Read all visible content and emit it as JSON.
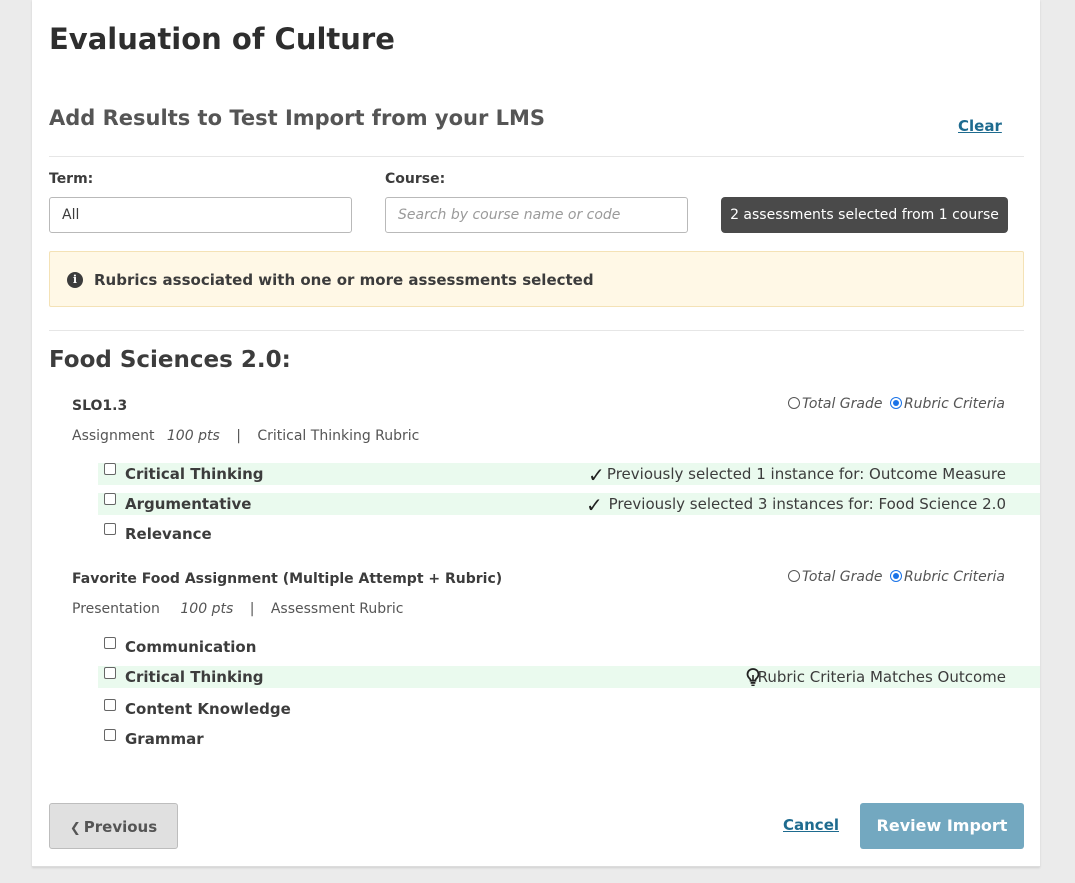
{
  "page_title": "Evaluation of Culture",
  "section": {
    "title": "Add Results to Test Import from your LMS",
    "clear_label": "Clear"
  },
  "filters": {
    "term_label": "Term:",
    "term_value": "All",
    "course_label": "Course:",
    "course_placeholder": "Search by course name or code",
    "selection_summary": "2 assessments selected from 1 course"
  },
  "notice": {
    "icon": "info-icon",
    "text": "Rubrics associated with one or more assessments selected"
  },
  "group": {
    "title": "Food Sciences 2.0:",
    "assessments": [
      {
        "name": "SLO1.3",
        "type": "Assignment",
        "points": "100 pts",
        "separator": "|",
        "rubric": "Critical Thinking Rubric",
        "options": [
          "Total Grade",
          "Rubric Criteria"
        ],
        "selected_option": "Rubric Criteria",
        "criteria": [
          {
            "label": "Critical Thinking",
            "status": "Previously selected 1 instance for: Outcome Measure",
            "status_icon": "check-icon",
            "highlighted": true
          },
          {
            "label": "Argumentative",
            "status": "Previously selected 3 instances for: Food Science 2.0",
            "status_icon": "check-icon",
            "highlighted": true
          },
          {
            "label": "Relevance",
            "status": "",
            "highlighted": false
          }
        ]
      },
      {
        "name": "Favorite Food Assignment (Multiple Attempt + Rubric)",
        "type": "Presentation",
        "points": "100 pts",
        "separator": "|",
        "rubric": "Assessment Rubric",
        "options": [
          "Total Grade",
          "Rubric Criteria"
        ],
        "selected_option": "Rubric Criteria",
        "criteria": [
          {
            "label": "Communication",
            "status": "",
            "highlighted": false
          },
          {
            "label": "Critical Thinking",
            "status": "Rubric Criteria Matches Outcome",
            "status_icon": "lightbulb-icon",
            "highlighted": true
          },
          {
            "label": "Content Knowledge",
            "status": "",
            "highlighted": false
          },
          {
            "label": "Grammar",
            "status": "",
            "highlighted": false
          }
        ]
      }
    ]
  },
  "footer": {
    "previous_label": "Previous",
    "cancel_label": "Cancel",
    "review_label": "Review Import"
  },
  "colors": {
    "accent": "#1e6b8f",
    "primary_button": "#73a8c0",
    "highlight_row": "#eafaee",
    "notice_bg": "#fff8e6",
    "badge_bg": "#4a4a4a"
  }
}
